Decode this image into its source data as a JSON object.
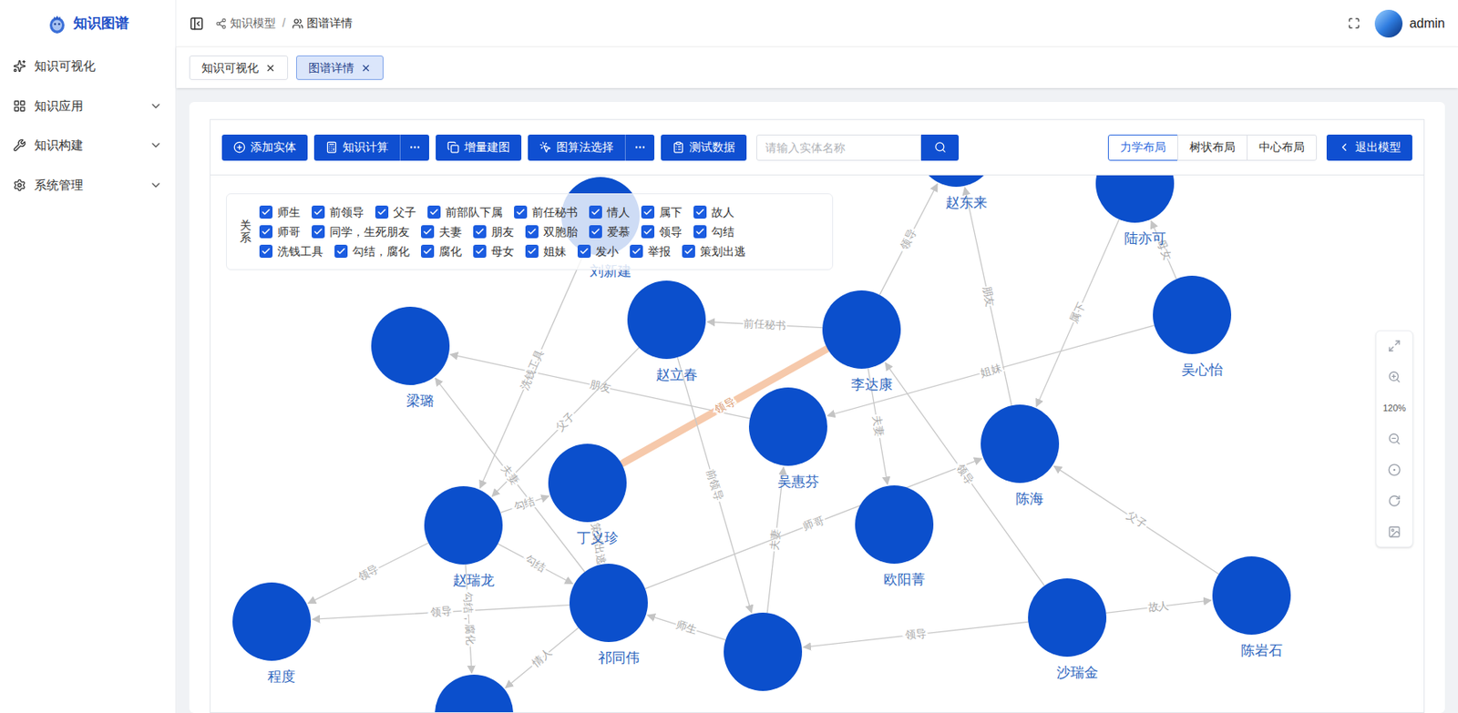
{
  "app": {
    "logo_text": "知识图谱"
  },
  "sidebar": {
    "items": [
      {
        "label": "知识可视化",
        "has_submenu": false,
        "expanded": false
      },
      {
        "label": "知识应用",
        "has_submenu": true,
        "expanded": false
      },
      {
        "label": "知识构建",
        "has_submenu": true,
        "expanded": false
      },
      {
        "label": "系统管理",
        "has_submenu": true,
        "expanded": false
      }
    ]
  },
  "header": {
    "breadcrumb": [
      "知识模型",
      "图谱详情"
    ],
    "separator": "/",
    "user": "admin"
  },
  "tabs": [
    {
      "label": "知识可视化",
      "selected": false
    },
    {
      "label": "图谱详情",
      "selected": true
    }
  ],
  "toolbar": {
    "buttons": [
      {
        "label": "添加实体",
        "has_more": false
      },
      {
        "label": "知识计算",
        "has_more": true
      },
      {
        "label": "增量建图",
        "has_more": false
      },
      {
        "label": "图算法选择",
        "has_more": true
      },
      {
        "label": "测试数据",
        "has_more": false
      }
    ]
  },
  "search": {
    "placeholder": "请输入实体名称"
  },
  "layouts": [
    {
      "label": "力学布局",
      "selected": true
    },
    {
      "label": "树状布局",
      "selected": false
    },
    {
      "label": "中心布局",
      "selected": false
    }
  ],
  "exit_button": "退出模型",
  "legend": {
    "title": "关系",
    "rows": [
      [
        {
          "label": "师生",
          "checked": true
        },
        {
          "label": "前领导",
          "checked": true
        },
        {
          "label": "父子",
          "checked": true
        },
        {
          "label": "前部队下属",
          "checked": true
        },
        {
          "label": "前任秘书",
          "checked": true
        },
        {
          "label": "情人",
          "checked": true
        },
        {
          "label": "属下",
          "checked": true
        },
        {
          "label": "故人",
          "checked": true
        }
      ],
      [
        {
          "label": "师哥",
          "checked": true
        },
        {
          "label": "同学，生死朋友",
          "checked": true
        },
        {
          "label": "夫妻",
          "checked": true
        },
        {
          "label": "朋友",
          "checked": true
        },
        {
          "label": "双胞胎",
          "checked": true
        },
        {
          "label": "爱慕",
          "checked": true
        },
        {
          "label": "领导",
          "checked": true
        },
        {
          "label": "勾结",
          "checked": true
        }
      ],
      [
        {
          "label": "洗钱工具",
          "checked": true
        },
        {
          "label": "勾结，腐化",
          "checked": true
        },
        {
          "label": "腐化",
          "checked": true
        },
        {
          "label": "母女",
          "checked": true
        },
        {
          "label": "姐妹",
          "checked": true
        },
        {
          "label": "发小",
          "checked": true
        },
        {
          "label": "举报",
          "checked": true
        },
        {
          "label": "策划出逃",
          "checked": true
        }
      ]
    ]
  },
  "zoom": {
    "level": "120%"
  },
  "graph": {
    "nodes": [
      {
        "name": "刘新建"
      },
      {
        "name": "赵东来"
      },
      {
        "name": "陆亦可"
      },
      {
        "name": "梁璐"
      },
      {
        "name": "赵立春"
      },
      {
        "name": "李达康"
      },
      {
        "name": "吴心怡"
      },
      {
        "name": "吴惠芬"
      },
      {
        "name": "陈海"
      },
      {
        "name": "丁义珍"
      },
      {
        "name": "赵瑞龙"
      },
      {
        "name": "欧阳菁"
      },
      {
        "name": "程度"
      },
      {
        "name": "祁同伟"
      },
      {
        "name": "沙瑞金"
      },
      {
        "name": "陈岩石"
      },
      {
        "name": ""
      },
      {
        "name": ""
      }
    ],
    "edges": [
      {
        "from": 5,
        "to": 4,
        "label": "前任秘书",
        "highlighted": false
      },
      {
        "from": 5,
        "to": 1,
        "label": "领导",
        "highlighted": false
      },
      {
        "from": 8,
        "to": 1,
        "label": "朋友",
        "highlighted": false
      },
      {
        "from": 2,
        "to": 8,
        "label": "属下",
        "highlighted": false
      },
      {
        "from": 6,
        "to": 2,
        "label": "母女",
        "highlighted": false
      },
      {
        "from": 6,
        "to": 7,
        "label": "姐妹",
        "highlighted": false
      },
      {
        "from": 7,
        "to": 3,
        "label": "朋友",
        "highlighted": false
      },
      {
        "from": 5,
        "to": 11,
        "label": "夫妻",
        "highlighted": false
      },
      {
        "from": 5,
        "to": 9,
        "label": "领导",
        "highlighted": true
      },
      {
        "from": 4,
        "to": 16,
        "label": "前领导",
        "highlighted": false
      },
      {
        "from": 4,
        "to": 10,
        "label": "父子",
        "highlighted": false
      },
      {
        "from": 0,
        "to": 10,
        "label": "洗钱工具",
        "highlighted": false
      },
      {
        "from": 13,
        "to": 3,
        "label": "夫妻",
        "highlighted": false
      },
      {
        "from": 10,
        "to": 9,
        "label": "勾结",
        "highlighted": false
      },
      {
        "from": 10,
        "to": 13,
        "label": "勾结",
        "highlighted": false
      },
      {
        "from": 10,
        "to": 12,
        "label": "领导",
        "highlighted": false
      },
      {
        "from": 13,
        "to": 12,
        "label": "领导",
        "highlighted": false
      },
      {
        "from": 10,
        "to": 17,
        "label": "勾结，腐化",
        "highlighted": false
      },
      {
        "from": 13,
        "to": 9,
        "label": "策划出逃",
        "highlighted": false
      },
      {
        "from": 13,
        "to": 17,
        "label": "情人",
        "highlighted": false
      },
      {
        "from": 16,
        "to": 13,
        "label": "师生",
        "highlighted": false
      },
      {
        "from": 16,
        "to": 7,
        "label": "夫妻",
        "highlighted": false
      },
      {
        "from": 13,
        "to": 8,
        "label": "师哥",
        "highlighted": false
      },
      {
        "from": 14,
        "to": 5,
        "label": "领导",
        "highlighted": false
      },
      {
        "from": 14,
        "to": 16,
        "label": "领导",
        "highlighted": false
      },
      {
        "from": 14,
        "to": 15,
        "label": "故人",
        "highlighted": false
      },
      {
        "from": 15,
        "to": 8,
        "label": "父子",
        "highlighted": false
      }
    ]
  }
}
